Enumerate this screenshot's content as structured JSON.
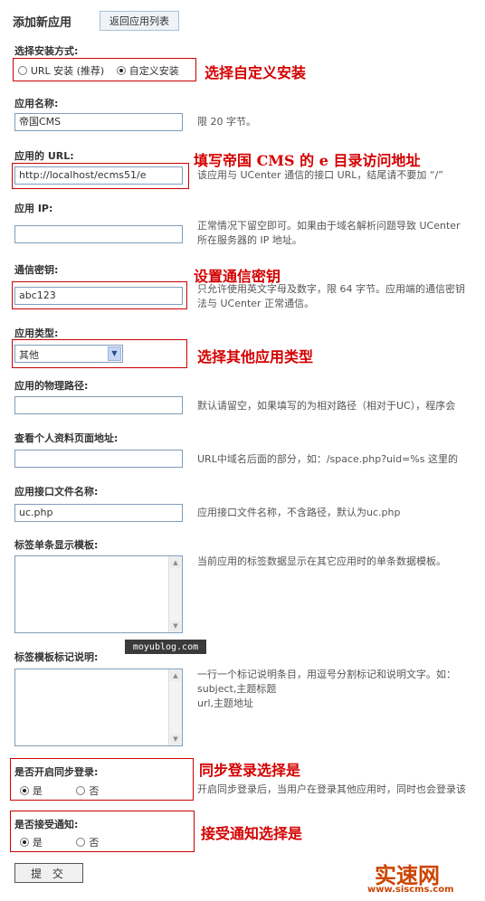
{
  "header": {
    "title": "添加新应用",
    "back_label": "返回应用列表"
  },
  "install": {
    "label": "选择安装方式:",
    "options": [
      {
        "label": "URL 安装 (推荐)",
        "selected": false
      },
      {
        "label": "自定义安装",
        "selected": true
      }
    ],
    "annotation": "选择自定义安装"
  },
  "app_name": {
    "label": "应用名称:",
    "value": "帝国CMS",
    "note": "限 20 字节。"
  },
  "app_url": {
    "label": "应用的 URL:",
    "value": "http://localhost/ecms51/e",
    "note": "该应用与 UCenter 通信的接口 URL，结尾请不要加 “/”",
    "annotation": "填写帝国 CMS 的 e 目录访问地址"
  },
  "app_ip": {
    "label": "应用 IP:",
    "value": "",
    "note": "正常情况下留空即可。如果由于域名解析问题导致 UCenter",
    "note2": "所在服务器的 IP 地址。"
  },
  "comm_key": {
    "label": "通信密钥:",
    "value": "abc123",
    "note": "只允许使用英文字母及数字，限 64 字节。应用端的通信密钥",
    "note2": "法与 UCenter 正常通信。",
    "annotation": "设置通信密钥"
  },
  "app_type": {
    "label": "应用类型:",
    "value": "其他",
    "annotation": "选择其他应用类型"
  },
  "app_path": {
    "label": "应用的物理路径:",
    "value": "",
    "note": "默认请留空，如果填写的为相对路径（相对于UC），程序会"
  },
  "profile_url": {
    "label": "查看个人资料页面地址:",
    "value": "",
    "note": "URL中域名后面的部分，如：/space.php?uid=%s 这里的"
  },
  "api_filename": {
    "label": "应用接口文件名称:",
    "value": "uc.php",
    "note": "应用接口文件名称，不含路径，默认为uc.php"
  },
  "tag_template": {
    "label": "标签单条显示模板:",
    "note": "当前应用的标签数据显示在其它应用时的单条数据模板。"
  },
  "tag_desc": {
    "label": "标签模板标记说明:",
    "note": "一行一个标记说明条目，用逗号分割标记和说明文字。如：",
    "example1": "subject,主题标题",
    "example2": "url,主题地址",
    "watermark": "moyublog.com"
  },
  "sync_login": {
    "label": "是否开启同步登录:",
    "yes": "是",
    "no": "否",
    "note": "开启同步登录后，当用户在登录其他应用时，同时也会登录该",
    "annotation": "同步登录选择是"
  },
  "notify": {
    "label": "是否接受通知:",
    "yes": "是",
    "no": "否",
    "annotation": "接受通知选择是"
  },
  "submit_label": "提 交",
  "brand": {
    "name": "实速网",
    "url": "www.siscms.com"
  },
  "colors": {
    "annotation": "#d40000",
    "brand": "#cc4400"
  }
}
